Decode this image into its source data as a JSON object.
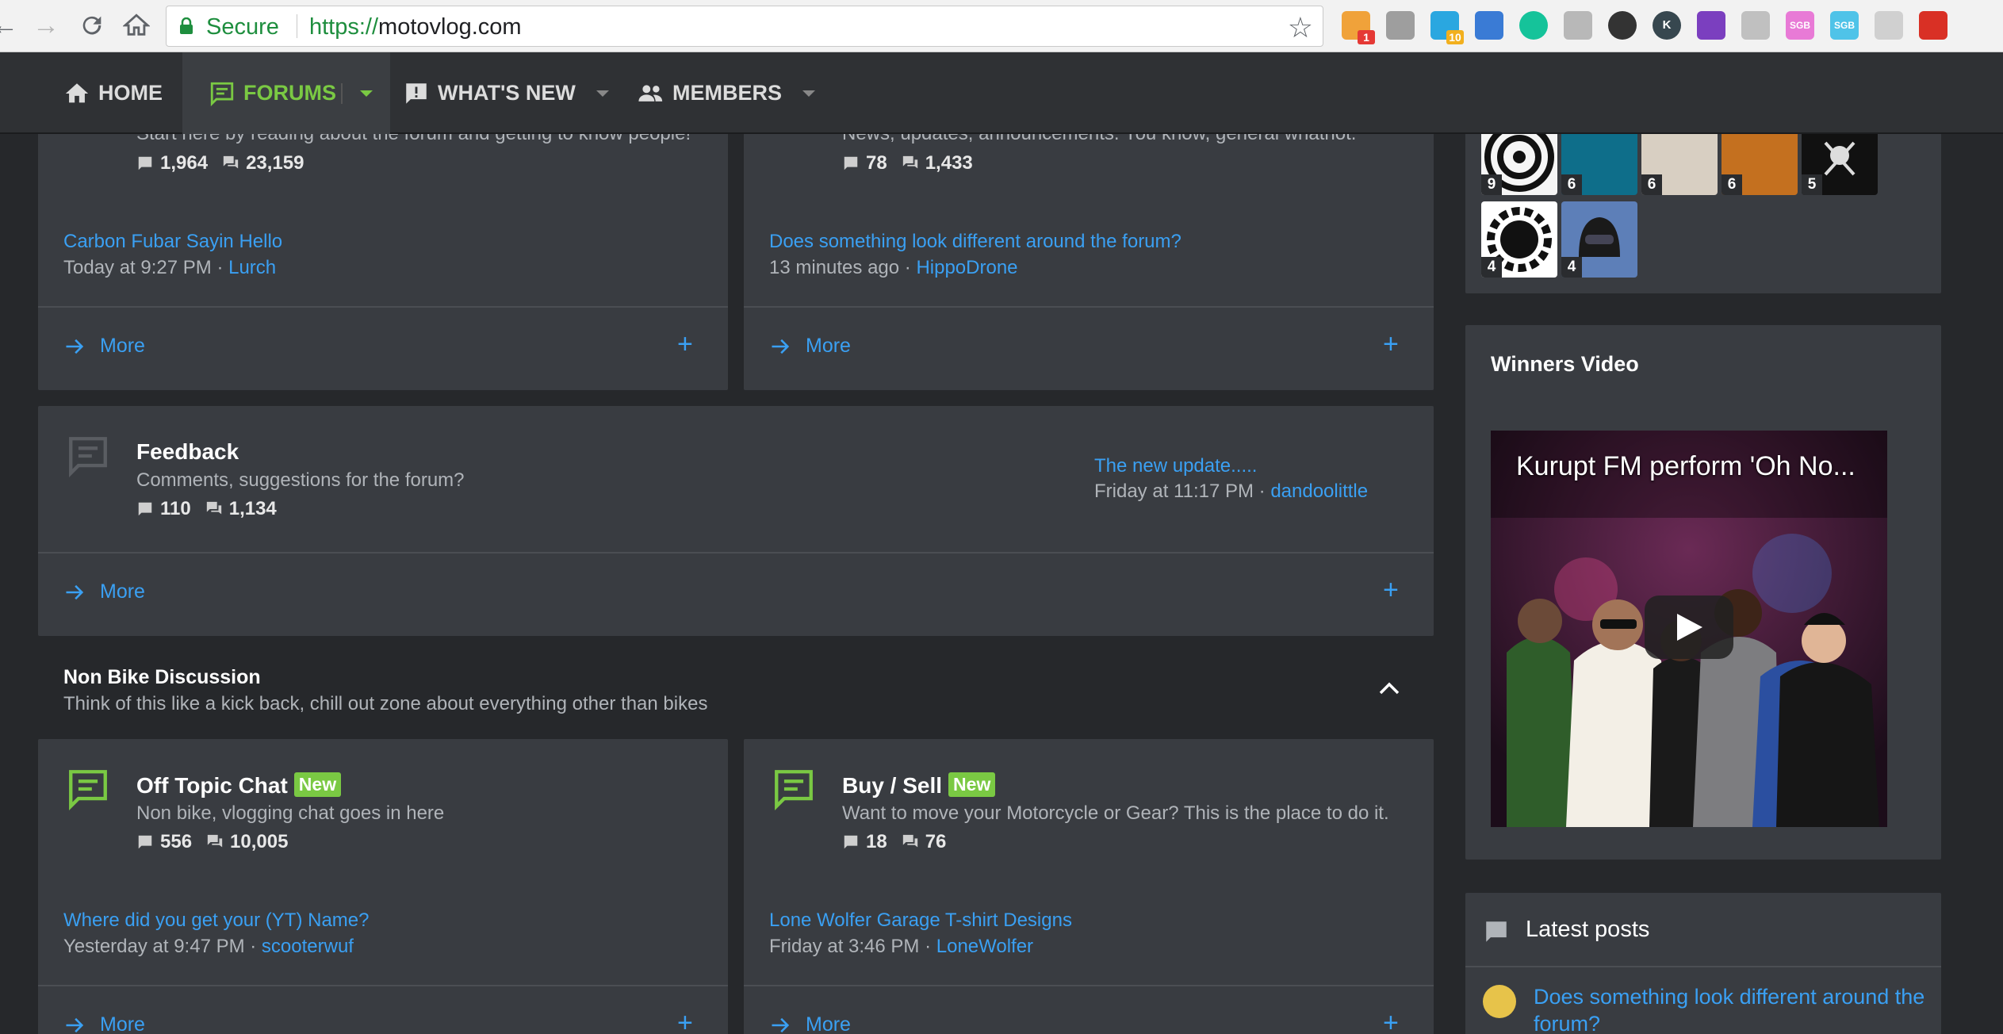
{
  "browser": {
    "secure_label": "Secure",
    "url_scheme": "https://",
    "url_host": "motovlog.com",
    "extensions": [
      {
        "icon": "puzzle-icon",
        "color": "#f0a23a",
        "badge": "1"
      },
      {
        "icon": "gear-icon",
        "color": "#9e9e9e",
        "badge": ""
      },
      {
        "icon": "ghostery-icon",
        "color": "#2aa7e0",
        "badge": "10"
      },
      {
        "icon": "refresh-sync-icon",
        "color": "#3a7bd5",
        "badge": ""
      },
      {
        "icon": "grammarly-icon",
        "color": "#15c39a",
        "badge": ""
      },
      {
        "icon": "inbox-icon",
        "color": "#b8b8b8",
        "badge": ""
      },
      {
        "icon": "spy-icon",
        "color": "#333333",
        "badge": ""
      },
      {
        "icon": "k-icon",
        "color": "#37474f",
        "badge": ""
      },
      {
        "icon": "gem-icon",
        "color": "#7b3fbf",
        "badge": ""
      },
      {
        "icon": "tool-icon",
        "color": "#c0c0c0",
        "badge": ""
      },
      {
        "icon": "sgb-icon",
        "color": "#e87ad6",
        "badge": ""
      },
      {
        "icon": "sgb-icon",
        "color": "#4fc3e8",
        "badge": ""
      },
      {
        "icon": "note-icon",
        "color": "#d0d0d0",
        "badge": ""
      },
      {
        "icon": "arrow-icon",
        "color": "#d93025",
        "badge": ""
      }
    ],
    "ext_labels": {
      "k": "K",
      "sgb": "SGB"
    }
  },
  "nav": {
    "home": "HOME",
    "forums": "FORUMS",
    "whats_new": "WHAT'S NEW",
    "members": "MEMBERS"
  },
  "colors": {
    "accent_green": "#7ac943",
    "link_blue": "#3aa0f3",
    "card_bg": "#393c41",
    "page_bg": "#26282b"
  },
  "welcome_card": {
    "desc": "Start here by reading about the forum and getting to know people!",
    "threads": "1,964",
    "messages": "23,159",
    "latest_title": "Carbon Fubar Sayin Hello",
    "latest_time": "Today at 9:27 PM",
    "latest_user": "Lurch",
    "more": "More"
  },
  "news_card": {
    "desc": "News, updates, announcements. You know, general whatnot.",
    "threads": "78",
    "messages": "1,433",
    "latest_title": "Does something look different around the forum?",
    "latest_time": "13 minutes ago",
    "latest_user": "HippoDrone",
    "more": "More"
  },
  "feedback_card": {
    "title": "Feedback",
    "desc": "Comments, suggestions for the forum?",
    "threads": "110",
    "messages": "1,134",
    "latest_title": "The new update.....",
    "latest_time": "Friday at 11:17 PM",
    "latest_user": "dandoolittle",
    "more": "More"
  },
  "section": {
    "title": "Non Bike Discussion",
    "desc": "Think of this like a kick back, chill out zone about everything other than bikes"
  },
  "offtopic_card": {
    "title": "Off Topic Chat",
    "badge": "New",
    "desc": "Non bike, vlogging chat goes in here",
    "threads": "556",
    "messages": "10,005",
    "latest_title": "Where did you get your (YT) Name?",
    "latest_time": "Yesterday at 9:47 PM",
    "latest_user": "scooterwuf",
    "more": "More"
  },
  "buysell_card": {
    "title": "Buy / Sell",
    "badge": "New",
    "desc": "Want to move your Motorcycle or Gear? This is the place to do it.",
    "threads": "18",
    "messages": "76",
    "latest_title": "Lone Wolfer Garage T-shirt Designs",
    "latest_time": "Friday at 3:46 PM",
    "latest_user": "LoneWolfer",
    "more": "More"
  },
  "sidebar": {
    "avatars": [
      {
        "count": "9",
        "color": "#f5f5f5",
        "icon": "target-logo-icon"
      },
      {
        "count": "6",
        "color": "#0e6e8a",
        "icon": "rider-avatar-icon"
      },
      {
        "count": "6",
        "color": "#d8cfc2",
        "icon": "motorcycle-avatar-icon"
      },
      {
        "count": "6",
        "color": "#c4701f",
        "icon": "road-avatar-icon"
      },
      {
        "count": "5",
        "color": "#111111",
        "icon": "skull-logo-icon"
      },
      {
        "count": "4",
        "color": "#ffffff",
        "icon": "gear-logo-icon"
      },
      {
        "count": "4",
        "color": "#5d7fb8",
        "icon": "helmet-avatar-icon"
      }
    ],
    "video_widget_title": "Winners Video",
    "video_title": "Kurupt FM perform 'Oh No...",
    "latest_title": "Latest posts",
    "latest_post": "Does something look different around the forum?"
  }
}
